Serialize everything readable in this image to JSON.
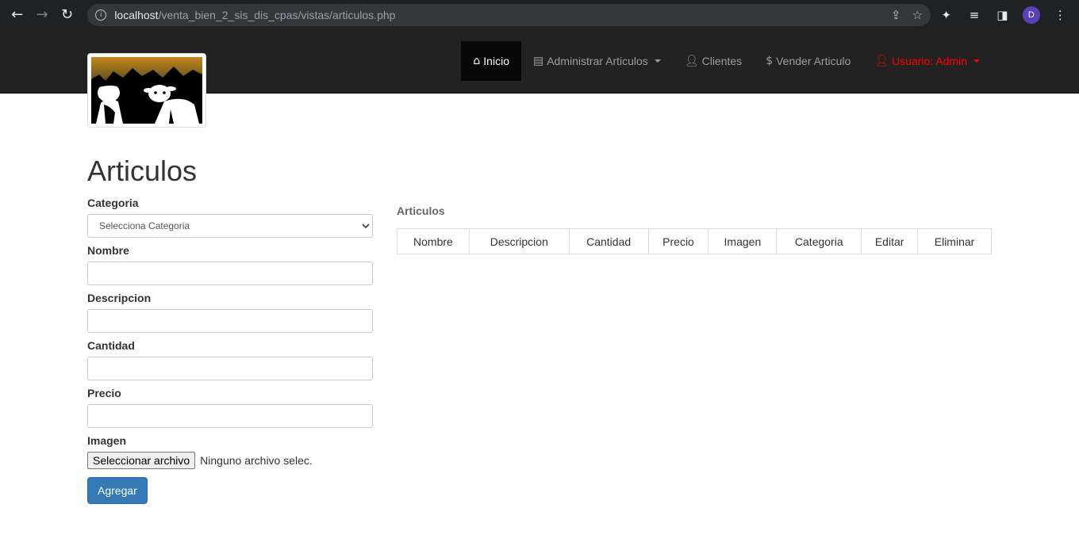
{
  "browser": {
    "url_host": "localhost",
    "url_path": "/venta_bien_2_sis_dis_cpas/vistas/articulos.php",
    "avatar_letter": "D"
  },
  "navbar": {
    "items": [
      {
        "label": "Inicio",
        "icon": "home-icon"
      },
      {
        "label": "Administrar Articulos",
        "icon": "list-icon"
      },
      {
        "label": "Clientes",
        "icon": "user-icon"
      },
      {
        "label": "Vender Articulo",
        "icon": "dollar-icon"
      },
      {
        "label": "Usuario: Admin",
        "icon": "user-icon"
      }
    ]
  },
  "page": {
    "title": "Articulos"
  },
  "form": {
    "categoria_label": "Categoria",
    "categoria_selected": "Selecciona Categoria",
    "nombre_label": "Nombre",
    "descripcion_label": "Descripcion",
    "cantidad_label": "Cantidad",
    "precio_label": "Precio",
    "imagen_label": "Imagen",
    "file_button": "Seleccionar archivo",
    "file_status": "Ninguno archivo selec.",
    "submit": "Agregar"
  },
  "table": {
    "title": "Articulos",
    "columns": [
      "Nombre",
      "Descripcion",
      "Cantidad",
      "Precio",
      "Imagen",
      "Categoria",
      "Editar",
      "Eliminar"
    ]
  },
  "colors": {
    "navbar_bg": "#222222",
    "primary": "#337ab7",
    "user_red": "#ff0000"
  }
}
